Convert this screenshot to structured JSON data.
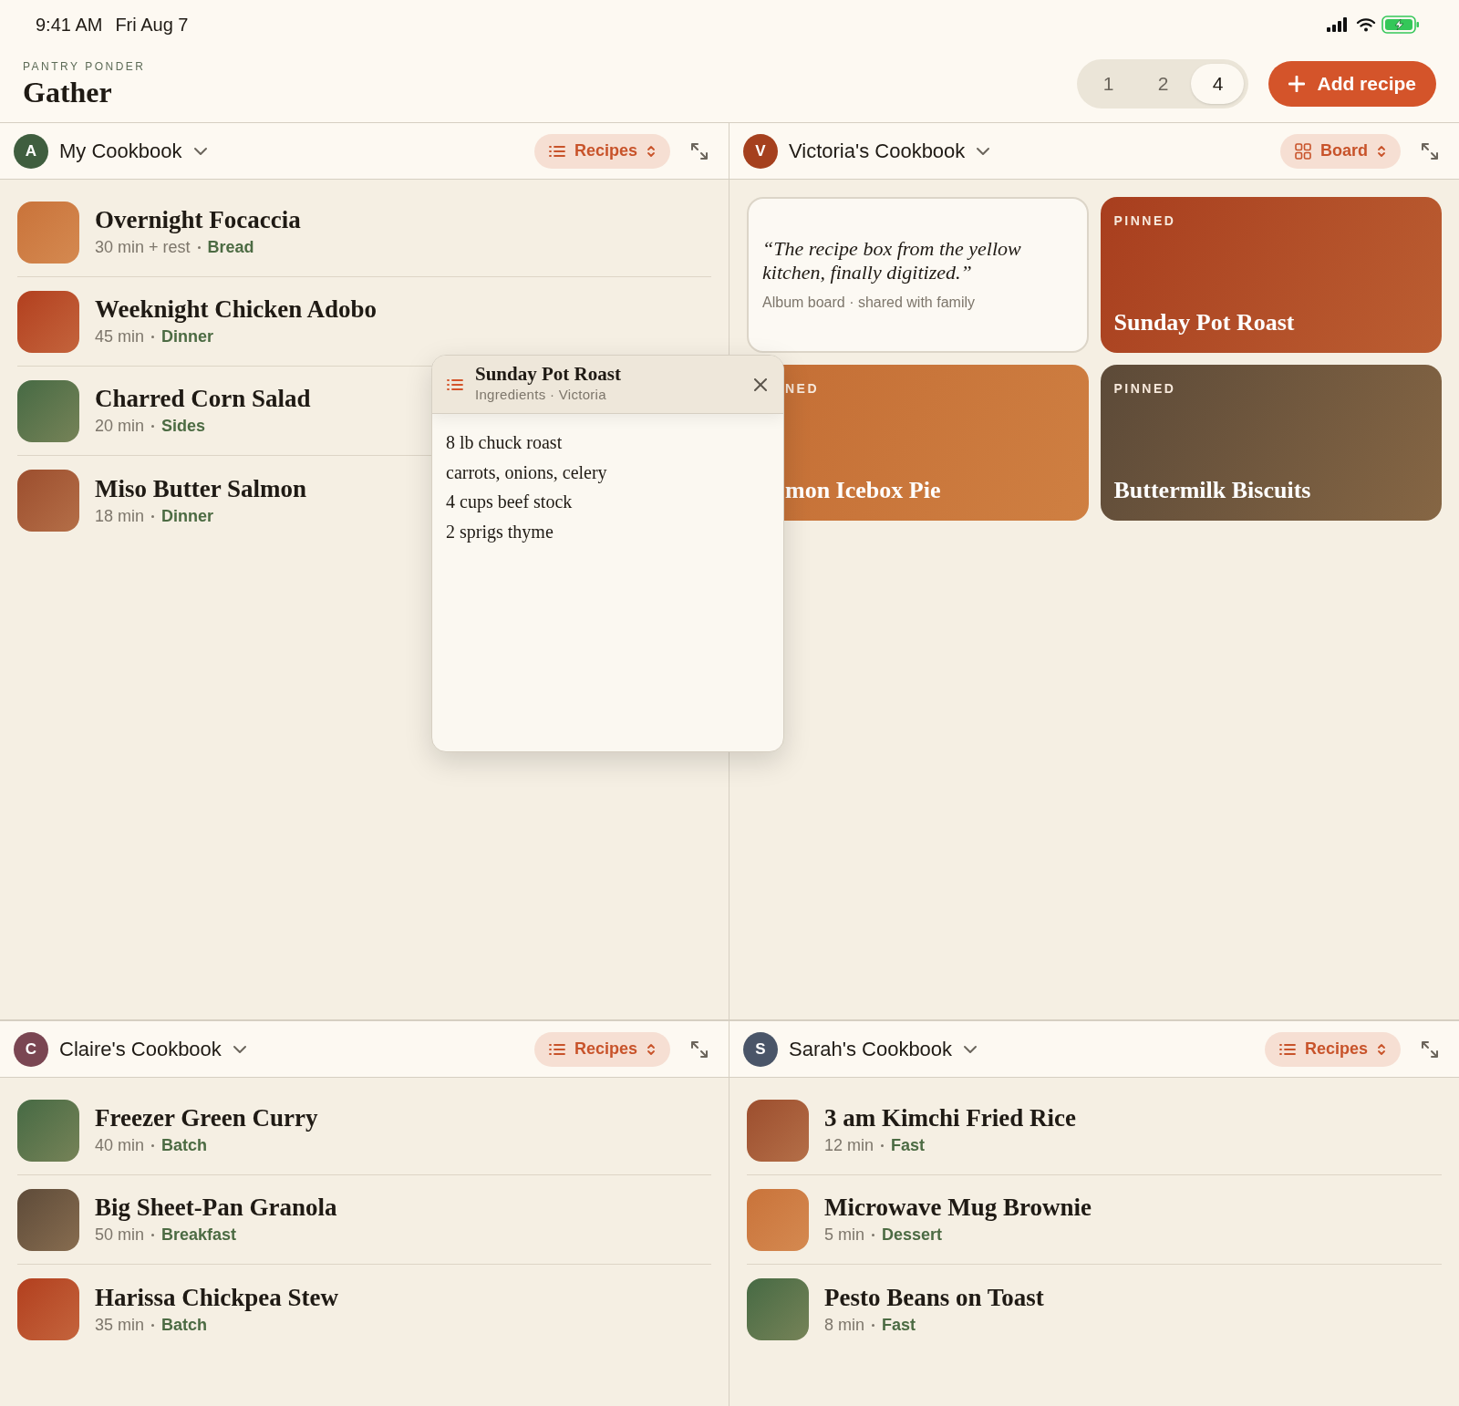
{
  "status_bar": {
    "time": "9:41 AM",
    "date": "Fri Aug 7"
  },
  "header": {
    "eyebrow": "PANTRY PONDER",
    "title": "Gather",
    "layout_options": [
      {
        "label": "1",
        "selected": false
      },
      {
        "label": "2",
        "selected": false
      },
      {
        "label": "4",
        "selected": true
      }
    ],
    "add_button": "Add recipe"
  },
  "panes": [
    {
      "owner": "My Cookbook",
      "avatar": "A",
      "color": "#3f5e3f",
      "view": {
        "label": "Recipes",
        "kind": "list"
      },
      "kind": "list",
      "recipes": [
        {
          "title": "Overnight Focaccia",
          "time": "30 min + rest",
          "tag": "Bread",
          "color": "#c9733a"
        },
        {
          "title": "Weeknight Chicken Adobo",
          "time": "45 min",
          "tag": "Dinner",
          "color": "#b23f1e"
        },
        {
          "title": "Charred Corn Salad",
          "time": "20 min",
          "tag": "Sides",
          "color": "#466a44"
        },
        {
          "title": "Miso Butter Salmon",
          "time": "18 min",
          "tag": "Dinner",
          "color": "#9c4e2e"
        }
      ]
    },
    {
      "owner": "Victoria's Cookbook",
      "avatar": "V",
      "color": "#a5401e",
      "view": {
        "label": "Board",
        "kind": "board"
      },
      "kind": "board",
      "cards": [
        {
          "kind": "note",
          "quote": "“The recipe box from the yellow kitchen, finally digitized.”",
          "caption": "Album board · shared with family"
        },
        {
          "kind": "pinned",
          "label": "PINNED",
          "title": "Sunday Pot Roast",
          "color": "#a83e1e",
          "covered": false
        },
        {
          "kind": "pinned",
          "label": "NED",
          "title": "mon Icebox Pie",
          "color": "#c46e35",
          "covered": true
        },
        {
          "kind": "pinned",
          "label": "PINNED",
          "title": "Buttermilk Biscuits",
          "color": "#5c4a38",
          "covered": false
        }
      ]
    },
    {
      "owner": "Claire's Cookbook",
      "avatar": "C",
      "color": "#7a4652",
      "view": {
        "label": "Recipes",
        "kind": "list"
      },
      "kind": "list",
      "recipes": [
        {
          "title": "Freezer Green Curry",
          "time": "40 min",
          "tag": "Batch",
          "color": "#466a44"
        },
        {
          "title": "Big Sheet-Pan Granola",
          "time": "50 min",
          "tag": "Breakfast",
          "color": "#5e4b39"
        },
        {
          "title": "Harissa Chickpea Stew",
          "time": "35 min",
          "tag": "Batch",
          "color": "#b23f1e"
        }
      ]
    },
    {
      "owner": "Sarah's Cookbook",
      "avatar": "S",
      "color": "#4a5568",
      "view": {
        "label": "Recipes",
        "kind": "list"
      },
      "kind": "list",
      "recipes": [
        {
          "title": "3 am Kimchi Fried Rice",
          "time": "12 min",
          "tag": "Fast",
          "color": "#9c4e2e"
        },
        {
          "title": "Microwave Mug Brownie",
          "time": "5 min",
          "tag": "Dessert",
          "color": "#c9733a"
        },
        {
          "title": "Pesto Beans on Toast",
          "time": "8 min",
          "tag": "Fast",
          "color": "#466a44"
        }
      ]
    }
  ],
  "popover": {
    "title": "Sunday Pot Roast",
    "subtitle": "Ingredients · Victoria",
    "items": [
      "8 lb chuck roast",
      "carrots, onions, celery",
      "4 cups beef stock",
      "2 sprigs thyme"
    ]
  }
}
